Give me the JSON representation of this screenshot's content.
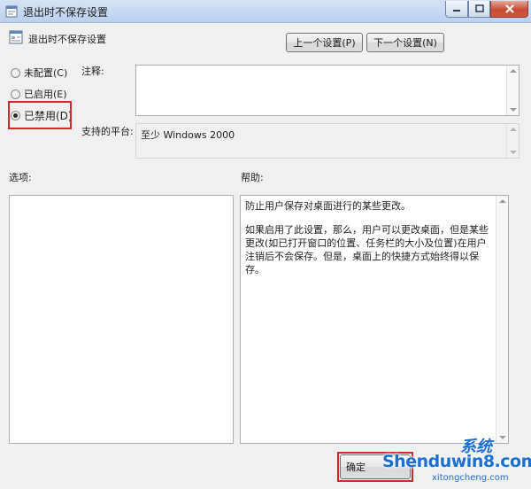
{
  "window": {
    "title": "退出时不保存设置",
    "minimize_icon": "minimize-icon",
    "maximize_icon": "maximize-icon",
    "close_icon": "close-icon"
  },
  "policy": {
    "name": "退出时不保存设置",
    "icon": "policy-settings-icon"
  },
  "nav": {
    "prev_label": "上一个设置(P)",
    "next_label": "下一个设置(N)"
  },
  "options_state": {
    "not_configured": "未配置(C)",
    "enabled": "已启用(E)",
    "disabled": "已禁用(D)",
    "selected": "disabled"
  },
  "comment": {
    "label": "注释:",
    "value": ""
  },
  "platform": {
    "label": "支持的平台:",
    "value": "至少 Windows 2000"
  },
  "options_label": "选项:",
  "help": {
    "label": "帮助:",
    "paragraphs": [
      "防止用户保存对桌面进行的某些更改。",
      "如果启用了此设置，那么，用户可以更改桌面，但是某些更改(如已打开窗口的位置、任务栏的大小及位置)在用户注销后不会保存。但是，桌面上的快捷方式始终得以保存。"
    ]
  },
  "footer": {
    "ok_label": "确定"
  },
  "watermark": {
    "main": "Shenduwin8.com",
    "top": "系统",
    "sub": "xitongcheng.com"
  },
  "colors": {
    "highlight": "#d7262a",
    "titlebar": "#c6daf2",
    "watermark": "#1b6fd0"
  }
}
